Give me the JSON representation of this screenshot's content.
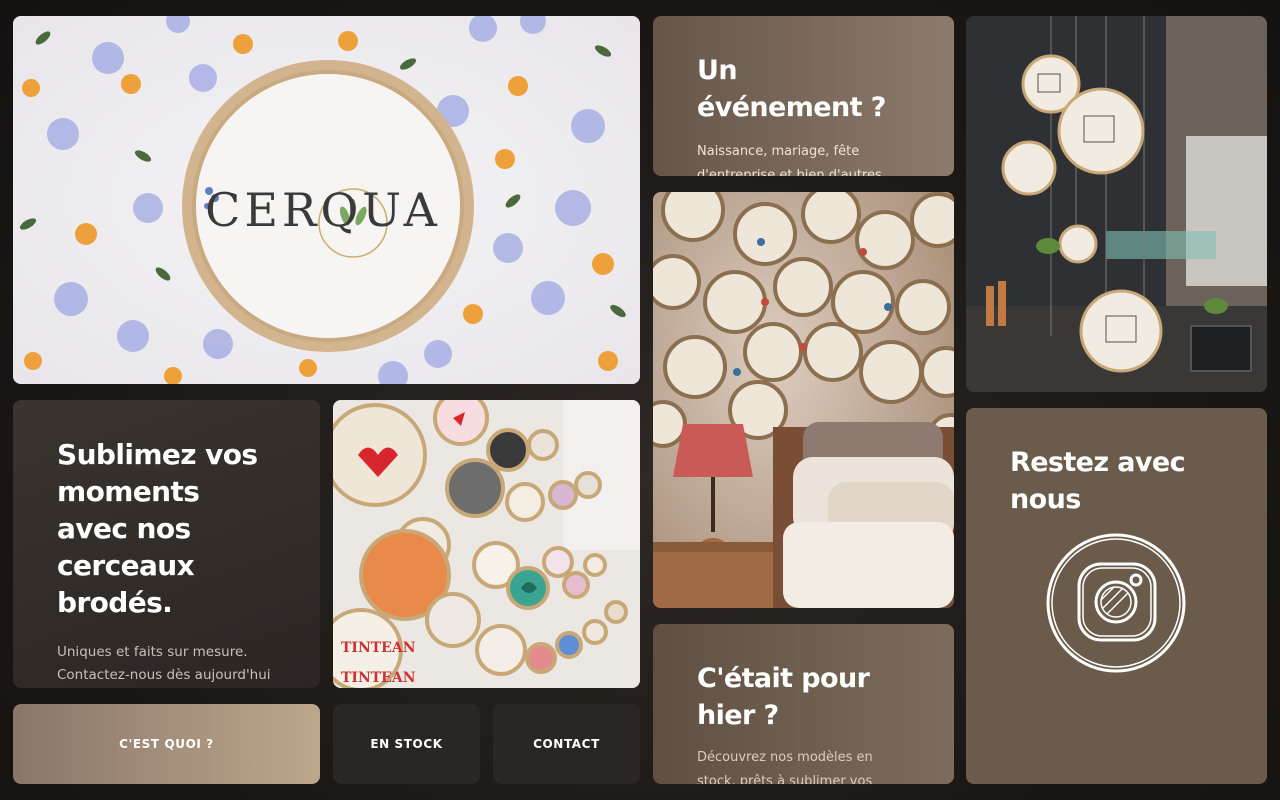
{
  "brand": {
    "logo_text": "CERQUA"
  },
  "hero": {
    "title": "Sublimez vos moments avec nos cerceaux brodés.",
    "text": "Uniques et faits sur mesure. Contactez-nous dès aujourd'hui pour obtenir votre devis sur mesure !"
  },
  "nav": {
    "what_label": "C'EST QUOI ?",
    "stock_label": "EN STOCK",
    "contact_label": "CONTACT"
  },
  "event": {
    "title": "Un événement ?",
    "text": "Naissance, mariage, fête d'entreprise et bien d'autres..."
  },
  "yesterday": {
    "title": "C'était pour hier ?",
    "text": "Découvrez nos modèles en stock, prêts à sublimer vos"
  },
  "social": {
    "title": "Restez avec nous",
    "icon": "instagram-icon"
  },
  "colors": {
    "background": "#1a1715",
    "accent_start": "#8a7669",
    "accent_end": "#bca78c",
    "card_brown": "#6b5b4b",
    "dark_button": "#2a2623"
  }
}
